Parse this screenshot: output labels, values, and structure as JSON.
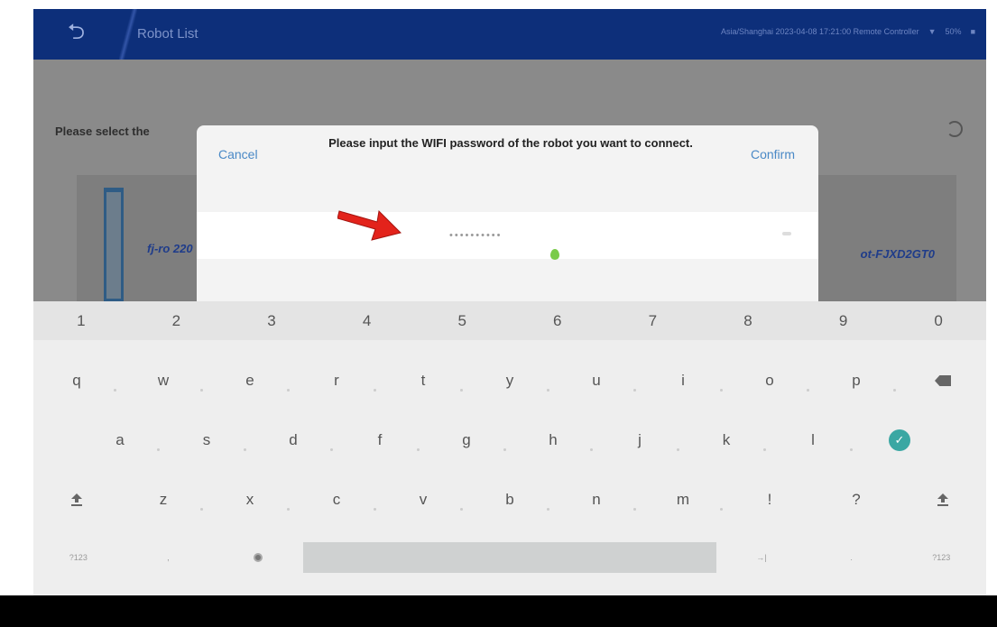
{
  "top_bar": {
    "back_icon": "back-icon",
    "title": "Robot List",
    "status_text": "Asia/Shanghai 2023-04-08 17:21:00  Remote Controller",
    "wifi_icon": "wifi-icon",
    "battery_text": "50%"
  },
  "page": {
    "instruction": "Please select the",
    "robot_name_left": "fj-ro 220",
    "robot_name_right": "ot-FJXD2GT0",
    "refresh_icon": "refresh-icon"
  },
  "dialog": {
    "cancel_label": "Cancel",
    "title": "Please input the WIFI password of the robot you want to connect.",
    "confirm_label": "Confirm",
    "password_value": "••••••••••",
    "eye_icon": "eye-icon"
  },
  "keyboard": {
    "numbers": [
      "1",
      "2",
      "3",
      "4",
      "5",
      "6",
      "7",
      "8",
      "9",
      "0"
    ],
    "row_q": [
      "q",
      "w",
      "e",
      "r",
      "t",
      "y",
      "u",
      "i",
      "o",
      "p"
    ],
    "row_a": [
      "a",
      "s",
      "d",
      "f",
      "g",
      "h",
      "j",
      "k",
      "l"
    ],
    "row_z": [
      "z",
      "x",
      "c",
      "v",
      "b",
      "n",
      "m",
      "!",
      "?"
    ],
    "symbols_label": "?123",
    "comma_label": ",",
    "arrow_label": "→|",
    "period_label": "."
  },
  "colors": {
    "top_bar": "#0d2f7a",
    "accent_link": "#4a89c6",
    "enter_key": "#3aa7a3",
    "arrow": "#e3231b"
  }
}
